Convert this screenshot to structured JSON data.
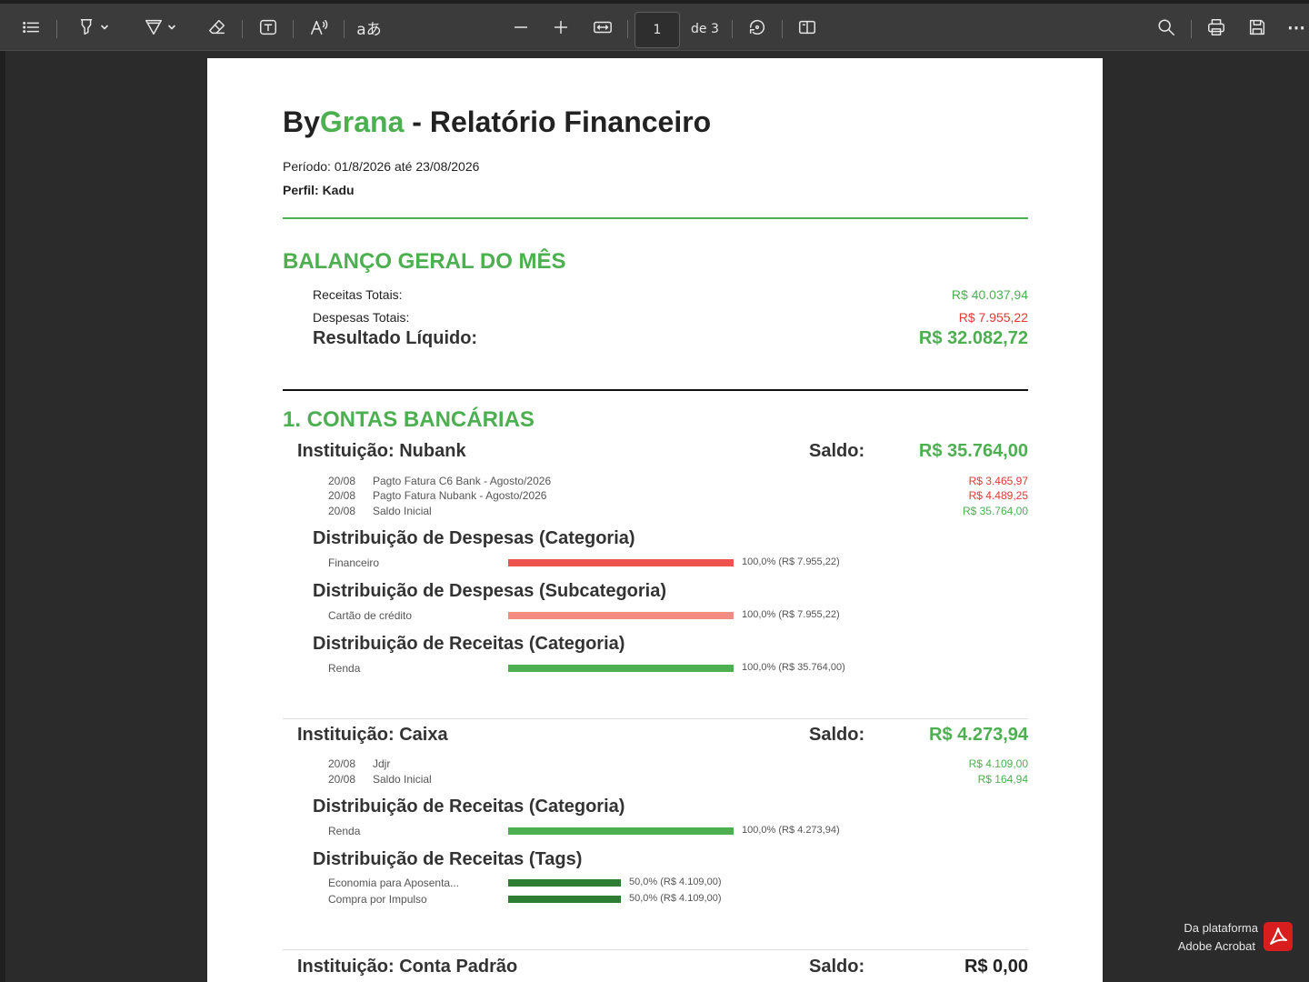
{
  "toolbar": {
    "icons": [
      "list-icon",
      "highlight-icon",
      "draw-icon",
      "eraser-icon",
      "text-box-icon",
      "read-aloud-icon",
      "translate-icon",
      "zoom-out-icon",
      "zoom-in-icon",
      "fit-width-icon",
      "rotate-icon",
      "page-view-icon",
      "search-icon",
      "print-icon",
      "save-icon",
      "more-icon"
    ],
    "page_number": "1",
    "page_total": "de 3",
    "translate_glyph": "aあ"
  },
  "report": {
    "title_by": "By",
    "title_grana": "Grana",
    "title_rest": " - Relatório Financeiro",
    "period": "Período: 01/8/2026 até 23/08/2026",
    "profile": "Perfil: Kadu",
    "balance": {
      "heading": "BALANÇO GERAL DO MÊS",
      "income_label": "Receitas Totais:",
      "income_value": "R$ 40.037,94",
      "expense_label": "Despesas Totais:",
      "expense_value": "R$ 7.955,22",
      "net_label": "Resultado Líquido:",
      "net_value": "R$ 32.082,72"
    },
    "accounts_heading": "1. CONTAS BANCÁRIAS",
    "balance_label": "Saldo:",
    "nubank": {
      "name": "Instituição: Nubank",
      "saldo": "R$ 35.764,00",
      "transactions": [
        {
          "date": "20/08",
          "desc": "Pagto Fatura C6 Bank - Agosto/2026",
          "value": "R$ 3.465,97"
        },
        {
          "date": "20/08",
          "desc": "Pagto Fatura Nubank - Agosto/2026",
          "value": "R$ 4.489,25"
        },
        {
          "date": "20/08",
          "desc": "Saldo Inicial",
          "value": "R$ 35.764,00"
        }
      ],
      "dist_exp_cat": "Distribuição de Despesas (Categoria)",
      "exp_cat_name": "Financeiro",
      "exp_cat_pct": "100,0% (R$ 7.955,22)",
      "exp_cat_share": 1.0,
      "dist_exp_sub": "Distribuição de Despesas (Subcategoria)",
      "exp_sub_name": "Cartão de crédito",
      "exp_sub_pct": "100,0% (R$ 7.955,22)",
      "exp_sub_share": 1.0,
      "dist_inc_cat": "Distribuição de Receitas (Categoria)",
      "inc_cat_name": "Renda",
      "inc_cat_pct": "100,0% (R$ 35.764,00)",
      "inc_cat_share": 1.0
    },
    "caixa": {
      "name": "Instituição: Caixa",
      "saldo": "R$ 4.273,94",
      "transactions": [
        {
          "date": "20/08",
          "desc": "Jdjr",
          "value": "R$ 4.109,00"
        },
        {
          "date": "20/08",
          "desc": "Saldo Inicial",
          "value": "R$ 164,94"
        }
      ],
      "dist_inc_cat": "Distribuição de Receitas (Categoria)",
      "inc_cat_name": "Renda",
      "inc_cat_pct": "100,0% (R$ 4.273,94)",
      "inc_cat_share": 1.0,
      "dist_inc_tags": "Distribuição de Receitas (Tags)",
      "tags": [
        {
          "name": "Economia para Aposenta...",
          "pct": "50,0% (R$ 4.109,00)",
          "share": 0.5
        },
        {
          "name": "Compra por Impulso",
          "pct": "50,0% (R$ 4.109,00)",
          "share": 0.5
        }
      ]
    },
    "padrao": {
      "name": "Instituição: Conta Padrão",
      "saldo": "R$ 0,00"
    }
  },
  "acrobat": {
    "line1": "Da plataforma",
    "line2": "Adobe Acrobat"
  },
  "colors": {
    "green": "#4caf50",
    "red": "#e53935",
    "salmon": "#f28b82",
    "dark_green": "#2e7d32"
  }
}
